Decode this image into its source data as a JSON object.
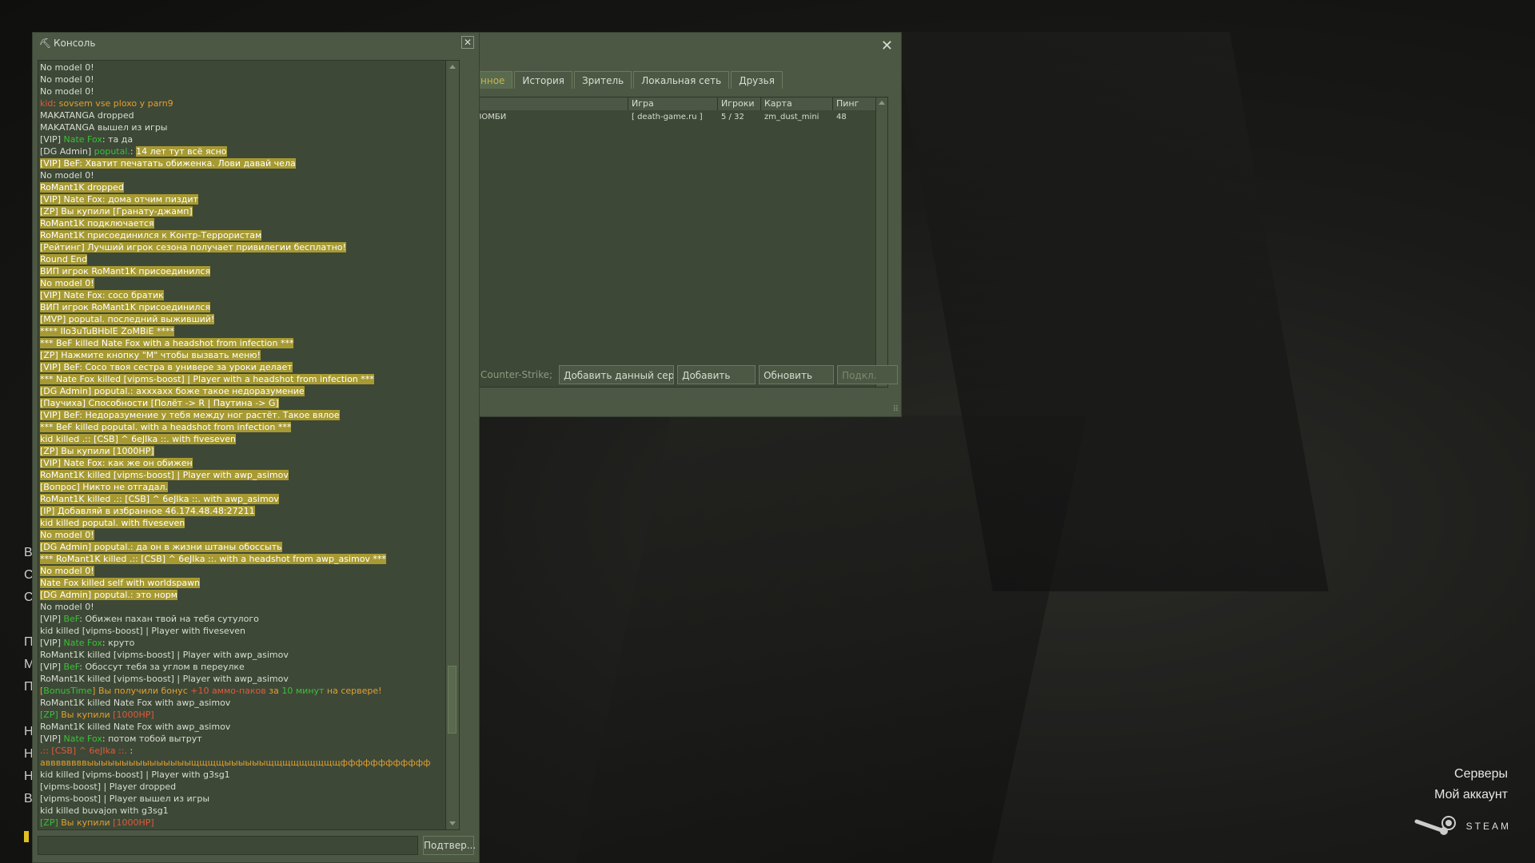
{
  "background_menu": {
    "left_items": [
      "В",
      "С",
      "С",
      "П",
      "М",
      "П",
      "Н",
      "Н",
      "Н",
      "В"
    ],
    "right_items": [
      "Серверы",
      "Мой аккаунт"
    ],
    "steam_label": "STEAM"
  },
  "server_browser": {
    "tabs": [
      "нное",
      "История",
      "Зритель",
      "Локальная сеть",
      "Друзья"
    ],
    "active_tab": 0,
    "columns": [
      "",
      "Игра",
      "Игроки",
      "Карта",
      "Пинг"
    ],
    "rows": [
      {
        "name": "ЗОМБИ",
        "game": "[ death-game.ru ]",
        "players": "5 / 32",
        "map": "zm_dust_mini",
        "ping": "48"
      }
    ],
    "footer": {
      "filter_label": "Counter-Strike;",
      "add_current": "Добавить данный серве",
      "add": "Добавить",
      "refresh": "Обновить",
      "connect": "Подкл."
    }
  },
  "console": {
    "title": "Консоль",
    "submit_label": "Подтвер...",
    "input_value": "",
    "colors": {
      "normal": "#d8ded3",
      "highlight_bg": "#a79a32",
      "red": "#e05a3a",
      "green": "#3ac03a",
      "orange": "#e0a030"
    },
    "lines": [
      {
        "segs": [
          {
            "t": "No model 0!"
          }
        ]
      },
      {
        "segs": [
          {
            "t": "No model 0!"
          }
        ]
      },
      {
        "segs": [
          {
            "t": "No model 0!"
          }
        ]
      },
      {
        "segs": [
          {
            "t": "kid",
            "c": "#e05a3a"
          },
          {
            "t": ": sovsem vse ploxo y parn9",
            "c": "#e0a030"
          }
        ]
      },
      {
        "segs": [
          {
            "t": "MAKATANGA dropped"
          }
        ]
      },
      {
        "segs": [
          {
            "t": "MAKATANGA вышел из игры"
          }
        ]
      },
      {
        "segs": [
          {
            "t": "[VIP] "
          },
          {
            "t": "Nate Fox",
            "c": "#3ac03a"
          },
          {
            "t": ": та да"
          }
        ]
      },
      {
        "segs": [
          {
            "t": "[DG Admin] "
          },
          {
            "t": "poputal.",
            "c": "#3ac03a"
          },
          {
            "t": ": "
          },
          {
            "t": "14 лет тут всё ясно",
            "hl": true
          }
        ]
      },
      {
        "hl": true,
        "segs": [
          {
            "t": "[VIP] BeF: Хватит печатать обиженка. Лови давай чела"
          }
        ]
      },
      {
        "segs": [
          {
            "t": "No model 0!"
          }
        ]
      },
      {
        "hl": true,
        "segs": [
          {
            "t": "RoMant1K dropped"
          }
        ]
      },
      {
        "hl": true,
        "segs": [
          {
            "t": "[VIP] Nate Fox: дома отчим пиздит"
          }
        ]
      },
      {
        "hl": true,
        "segs": [
          {
            "t": "[ZP] Вы купили [Гранату-джамп]"
          }
        ]
      },
      {
        "hl": true,
        "segs": [
          {
            "t": "RoMant1K подключается"
          }
        ]
      },
      {
        "hl": true,
        "segs": [
          {
            "t": "RoMant1K присоединился к Контр-Террористам"
          }
        ]
      },
      {
        "hl": true,
        "segs": [
          {
            "t": "[Рейтинг] Лучший игрок сезона получает привилегии бесплатно!"
          }
        ]
      },
      {
        "hl": true,
        "segs": [
          {
            "t": "Round End"
          }
        ]
      },
      {
        "hl": true,
        "segs": [
          {
            "t": "ВИП игрок RoMant1K присоединился"
          }
        ]
      },
      {
        "hl": true,
        "segs": [
          {
            "t": "No model 0!"
          }
        ]
      },
      {
        "hl": true,
        "segs": [
          {
            "t": "[VIP] Nate Fox: coco братик"
          }
        ]
      },
      {
        "hl": true,
        "segs": [
          {
            "t": "ВИП игрок RoMant1K присоединился"
          }
        ]
      },
      {
        "hl": true,
        "segs": [
          {
            "t": "[MVP] poputal. последний выживший!"
          }
        ]
      },
      {
        "hl": true,
        "segs": [
          {
            "t": "**** IIo3uTuBHbIE ZoMBiE ****"
          }
        ]
      },
      {
        "hl": true,
        "segs": [
          {
            "t": "*** BeF killed Nate Fox with a headshot from infection ***"
          }
        ]
      },
      {
        "hl": true,
        "segs": [
          {
            "t": "[ZP] Нажмите кнопку \"M\" чтобы вызвать меню!"
          }
        ]
      },
      {
        "hl": true,
        "segs": [
          {
            "t": "[VIP] BeF: Coco твоя сестра в универе за уроки делает"
          }
        ]
      },
      {
        "hl": true,
        "segs": [
          {
            "t": "*** Nate Fox killed [vipms-boost] | Player with a headshot from infection ***"
          }
        ]
      },
      {
        "hl": true,
        "segs": [
          {
            "t": "[DG Admin] poputal.: ахххахх боже такое недоразумение"
          }
        ]
      },
      {
        "hl": true,
        "segs": [
          {
            "t": "[Паучиха] Способности [Полёт -> R | Паутина -> G]"
          }
        ]
      },
      {
        "hl": true,
        "segs": [
          {
            "t": "[VIP] BeF: Недоразумение у тебя между ног растёт. Такое вялое"
          }
        ]
      },
      {
        "hl": true,
        "segs": [
          {
            "t": "*** BeF killed poputal. with a headshot from infection ***"
          }
        ]
      },
      {
        "hl": true,
        "segs": [
          {
            "t": "kid killed .:: [CSB] ^ 6eJIka ::. with fiveseven"
          }
        ]
      },
      {
        "hl": true,
        "segs": [
          {
            "t": "[ZP] Вы купили [1000HP]"
          }
        ]
      },
      {
        "hl": true,
        "segs": [
          {
            "t": "[VIP] Nate Fox: как же он обижен"
          }
        ]
      },
      {
        "hl": true,
        "segs": [
          {
            "t": "RoMant1K killed [vipms-boost] | Player with awp_asimov"
          }
        ]
      },
      {
        "hl": true,
        "segs": [
          {
            "t": "[Вопрос] Никто не отгадал."
          }
        ]
      },
      {
        "hl": true,
        "segs": [
          {
            "t": "RoMant1K killed .:: [CSB] ^ 6eJIka ::. with awp_asimov"
          }
        ]
      },
      {
        "hl": true,
        "segs": [
          {
            "t": "[IP] Добавляй в избранное 46.174.48.48:27211"
          }
        ]
      },
      {
        "hl": true,
        "segs": [
          {
            "t": "kid killed poputal. with fiveseven"
          }
        ]
      },
      {
        "hl": true,
        "segs": [
          {
            "t": "No model 0!"
          }
        ]
      },
      {
        "hl": true,
        "segs": [
          {
            "t": "[DG Admin] poputal.: да он в жизни штаны обоссыть"
          }
        ]
      },
      {
        "hl": true,
        "segs": [
          {
            "t": "*** RoMant1K killed .:: [CSB] ^ 6eJIka ::. with a headshot from awp_asimov ***"
          }
        ]
      },
      {
        "hl": true,
        "segs": [
          {
            "t": "No model 0!"
          }
        ]
      },
      {
        "hl": true,
        "segs": [
          {
            "t": "Nate Fox killed self with worldspawn"
          }
        ]
      },
      {
        "hl": true,
        "segs": [
          {
            "t": "[DG Admin] poputal.: это норм"
          }
        ]
      },
      {
        "segs": [
          {
            "t": "No model 0!"
          }
        ]
      },
      {
        "segs": [
          {
            "t": "[VIP] "
          },
          {
            "t": "BeF",
            "c": "#3ac03a"
          },
          {
            "t": ": Обижен пахан твой на тебя сутулого"
          }
        ]
      },
      {
        "segs": [
          {
            "t": "kid killed [vipms-boost] | Player with fiveseven"
          }
        ]
      },
      {
        "segs": [
          {
            "t": "[VIP] "
          },
          {
            "t": "Nate Fox",
            "c": "#3ac03a"
          },
          {
            "t": ": круто"
          }
        ]
      },
      {
        "segs": [
          {
            "t": "RoMant1K killed [vipms-boost] | Player with awp_asimov"
          }
        ]
      },
      {
        "segs": [
          {
            "t": "[VIP] "
          },
          {
            "t": "BeF",
            "c": "#3ac03a"
          },
          {
            "t": ": Обоссут тебя за углом в переулке"
          }
        ]
      },
      {
        "segs": [
          {
            "t": "RoMant1K killed [vipms-boost] | Player with awp_asimov"
          }
        ]
      },
      {
        "segs": [
          {
            "t": "[",
            "c": "#e0a030"
          },
          {
            "t": "BonusTime",
            "c": "#3ac03a"
          },
          {
            "t": "] Вы получили бонус ",
            "c": "#e0a030"
          },
          {
            "t": "+10 аммо-паков",
            "c": "#e05a3a"
          },
          {
            "t": " за ",
            "c": "#e0a030"
          },
          {
            "t": "10 минут",
            "c": "#3ac03a"
          },
          {
            "t": " на сервере!",
            "c": "#e0a030"
          }
        ]
      },
      {
        "segs": [
          {
            "t": "RoMant1K killed Nate Fox with awp_asimov"
          }
        ]
      },
      {
        "segs": [
          {
            "t": "[ZP]",
            "c": "#3ac03a"
          },
          {
            "t": " Вы купили ",
            "c": "#e0a030"
          },
          {
            "t": "[1000HP]",
            "c": "#e05a3a"
          }
        ]
      },
      {
        "segs": [
          {
            "t": "RoMant1K killed Nate Fox with awp_asimov"
          }
        ]
      },
      {
        "segs": [
          {
            "t": "[VIP] "
          },
          {
            "t": "Nate Fox",
            "c": "#3ac03a"
          },
          {
            "t": ": потом тобой вытрут"
          }
        ]
      },
      {
        "segs": [
          {
            "t": ".:: [CSB] ^ 6eJIka ::.",
            "c": "#e05a3a"
          },
          {
            "t": " :"
          }
        ]
      },
      {
        "segs": [
          {
            "t": "аввввввввыыыыыыыыыыыыыыыщщщщыыыыыыщщщщщщщщщфффффффффффф",
            "c": "#e0a030"
          }
        ]
      },
      {
        "segs": [
          {
            "t": "kid killed [vipms-boost] | Player with g3sg1"
          }
        ]
      },
      {
        "segs": [
          {
            "t": "[vipms-boost] | Player dropped"
          }
        ]
      },
      {
        "segs": [
          {
            "t": "[vipms-boost] | Player вышел из игры"
          }
        ]
      },
      {
        "segs": [
          {
            "t": "kid killed buvajon with g3sg1"
          }
        ]
      },
      {
        "segs": [
          {
            "t": "[ZP]",
            "c": "#3ac03a"
          },
          {
            "t": " Вы купили ",
            "c": "#e0a030"
          },
          {
            "t": "[1000HP]",
            "c": "#e05a3a"
          }
        ]
      }
    ]
  }
}
